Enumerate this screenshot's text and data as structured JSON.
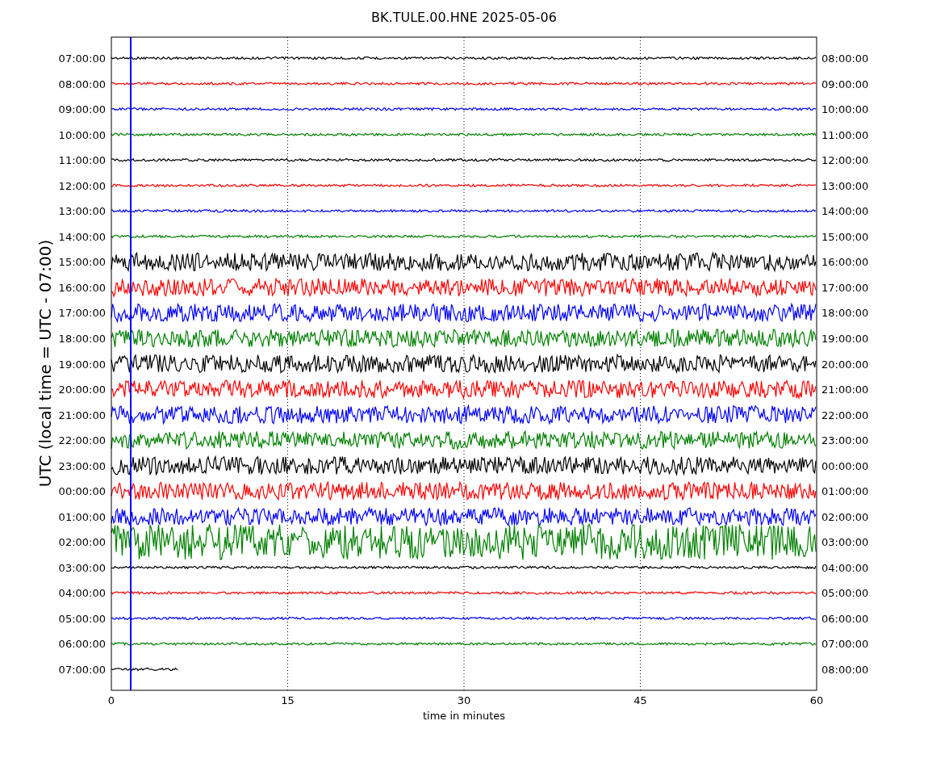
{
  "title": "BK.TULE.00.HNE 2025-05-06",
  "ylabel": "UTC (local time = UTC - 07:00)",
  "xlabel": "time in minutes",
  "xticks": [
    "0",
    "15",
    "30",
    "45",
    "60"
  ],
  "traces": [
    {
      "left": "07:00:00",
      "right": "08:00:00",
      "color": "#000000",
      "kind": "quiet"
    },
    {
      "left": "08:00:00",
      "right": "09:00:00",
      "color": "#ff0000",
      "kind": "quiet"
    },
    {
      "left": "09:00:00",
      "right": "10:00:00",
      "color": "#0000ff",
      "kind": "quiet"
    },
    {
      "left": "10:00:00",
      "right": "11:00:00",
      "color": "#008000",
      "kind": "quiet"
    },
    {
      "left": "11:00:00",
      "right": "12:00:00",
      "color": "#000000",
      "kind": "quiet"
    },
    {
      "left": "12:00:00",
      "right": "13:00:00",
      "color": "#ff0000",
      "kind": "quiet"
    },
    {
      "left": "13:00:00",
      "right": "14:00:00",
      "color": "#0000ff",
      "kind": "quiet"
    },
    {
      "left": "14:00:00",
      "right": "15:00:00",
      "color": "#008000",
      "kind": "quiet"
    },
    {
      "left": "15:00:00",
      "right": "16:00:00",
      "color": "#000000",
      "kind": "noisy"
    },
    {
      "left": "16:00:00",
      "right": "17:00:00",
      "color": "#ff0000",
      "kind": "noisy"
    },
    {
      "left": "17:00:00",
      "right": "18:00:00",
      "color": "#0000ff",
      "kind": "noisy"
    },
    {
      "left": "18:00:00",
      "right": "19:00:00",
      "color": "#008000",
      "kind": "noisy"
    },
    {
      "left": "19:00:00",
      "right": "20:00:00",
      "color": "#000000",
      "kind": "noisy"
    },
    {
      "left": "20:00:00",
      "right": "21:00:00",
      "color": "#ff0000",
      "kind": "noisy"
    },
    {
      "left": "21:00:00",
      "right": "22:00:00",
      "color": "#0000ff",
      "kind": "noisy"
    },
    {
      "left": "22:00:00",
      "right": "23:00:00",
      "color": "#008000",
      "kind": "noisy"
    },
    {
      "left": "23:00:00",
      "right": "00:00:00",
      "color": "#000000",
      "kind": "noisy"
    },
    {
      "left": "00:00:00",
      "right": "01:00:00",
      "color": "#ff0000",
      "kind": "noisy"
    },
    {
      "left": "01:00:00",
      "right": "02:00:00",
      "color": "#0000ff",
      "kind": "noisy"
    },
    {
      "left": "02:00:00",
      "right": "03:00:00",
      "color": "#008000",
      "kind": "loud"
    },
    {
      "left": "03:00:00",
      "right": "04:00:00",
      "color": "#000000",
      "kind": "quiet"
    },
    {
      "left": "04:00:00",
      "right": "05:00:00",
      "color": "#ff0000",
      "kind": "quiet"
    },
    {
      "left": "05:00:00",
      "right": "06:00:00",
      "color": "#0000ff",
      "kind": "quiet"
    },
    {
      "left": "06:00:00",
      "right": "07:00:00",
      "color": "#008000",
      "kind": "quiet"
    },
    {
      "left": "07:00:00",
      "right": "08:00:00",
      "color": "#000000",
      "kind": "short"
    }
  ]
}
